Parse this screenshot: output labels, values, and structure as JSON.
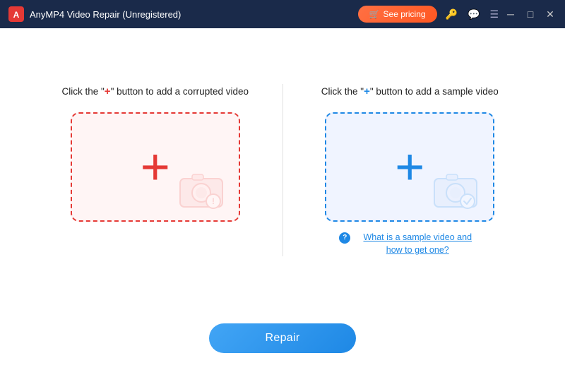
{
  "titlebar": {
    "title": "AnyMP4 Video Repair (Unregistered)",
    "pricing_label": "See pricing"
  },
  "left_panel": {
    "instruction_prefix": "Click the \"",
    "instruction_plus": "+",
    "instruction_suffix": "\" button to add a corrupted video"
  },
  "right_panel": {
    "instruction_prefix": "Click the \"",
    "instruction_plus": "+",
    "instruction_suffix": "\" button to add a sample video",
    "sample_link": "What is a sample video and how to get one?"
  },
  "repair_button": {
    "label": "Repair"
  },
  "colors": {
    "red_accent": "#e53935",
    "blue_accent": "#1e88e5"
  }
}
